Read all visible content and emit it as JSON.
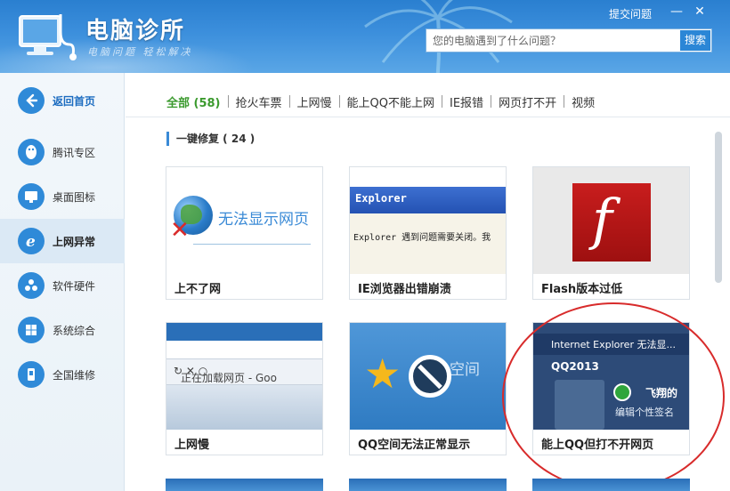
{
  "app": {
    "title": "电脑诊所",
    "subtitle": "电脑问题 轻松解决",
    "submit_issue": "提交问题",
    "search_placeholder": "您的电脑遇到了什么问题？",
    "search_button": "搜索"
  },
  "sidebar": {
    "items": [
      {
        "label": "返回首页",
        "icon": "back-arrow-icon"
      },
      {
        "label": "腾讯专区",
        "icon": "penguin-icon"
      },
      {
        "label": "桌面图标",
        "icon": "monitor-icon"
      },
      {
        "label": "上网异常",
        "icon": "ie-icon"
      },
      {
        "label": "软件硬件",
        "icon": "hardware-icon"
      },
      {
        "label": "系统综合",
        "icon": "windows-icon"
      },
      {
        "label": "全国维修",
        "icon": "phone-icon"
      }
    ],
    "active_index": 3
  },
  "tabs": [
    {
      "label": "全部 (58)",
      "active": true
    },
    {
      "label": "抢火车票"
    },
    {
      "label": "上网慢"
    },
    {
      "label": "能上QQ不能上网"
    },
    {
      "label": "IE报错"
    },
    {
      "label": "网页打不开"
    },
    {
      "label": "视频"
    }
  ],
  "section": {
    "label": "一键修复 ( 24 )"
  },
  "cards": [
    {
      "title": "上不了网",
      "thumb_text": "无法显示网页"
    },
    {
      "title": "IE浏览器出错崩溃",
      "thumb_header": "Explorer",
      "thumb_text": "Explorer 遇到问题需要关闭。我"
    },
    {
      "title": "Flash版本过低",
      "thumb_text": "f"
    },
    {
      "title": "上网慢",
      "thumb_text": "正在加载网页 - Goo"
    },
    {
      "title": "QQ空间无法正常显示",
      "thumb_text": "空间"
    },
    {
      "title": "能上QQ但打不开网页",
      "thumb_header": "Internet Explorer 无法显...",
      "thumb_qq": "QQ2013",
      "thumb_name": "飞翔的",
      "thumb_sig": "编辑个性签名"
    }
  ]
}
